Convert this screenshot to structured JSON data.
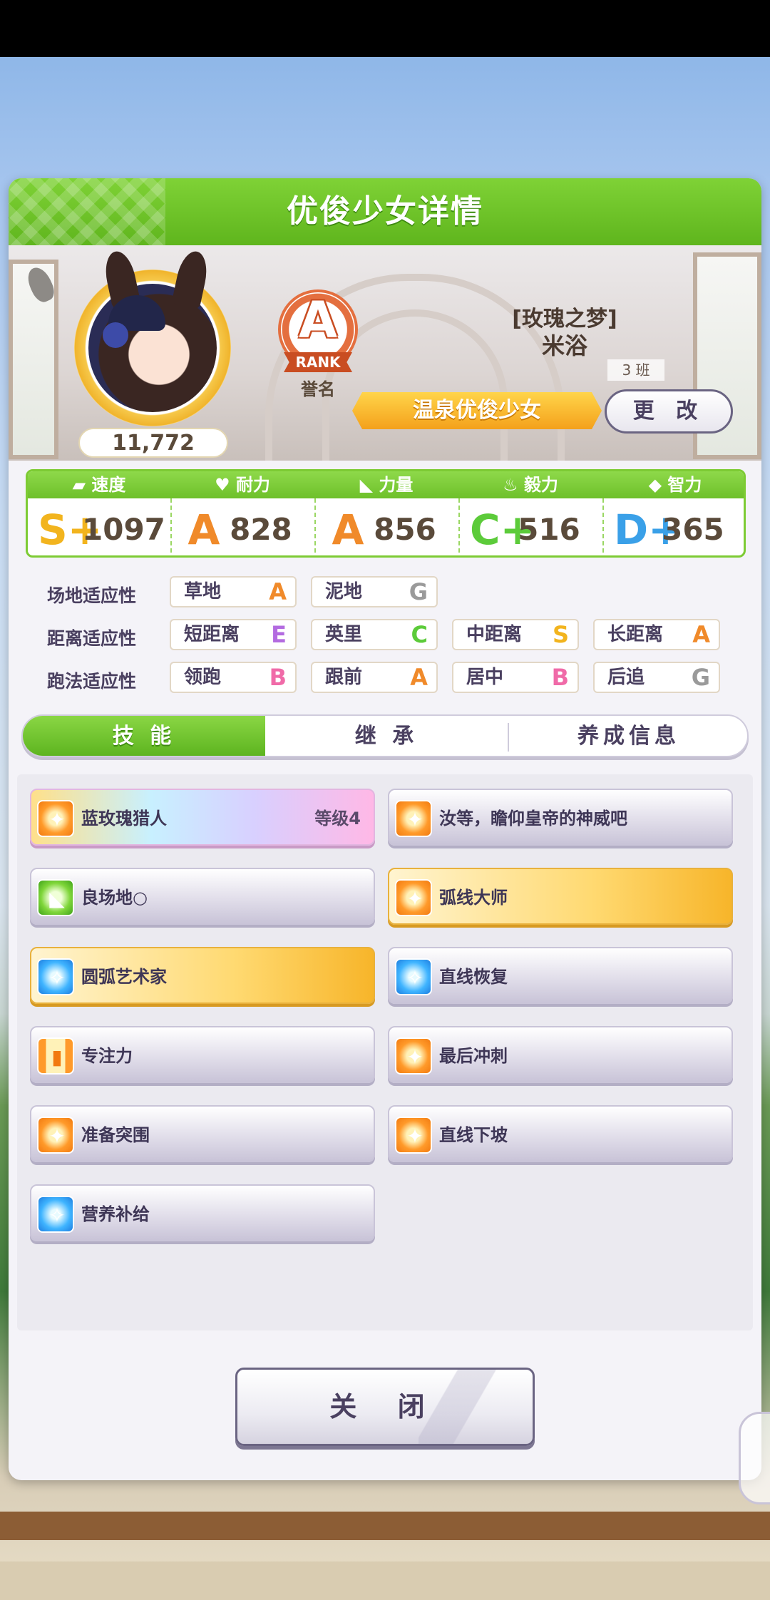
{
  "dialog": {
    "title": "优俊少女详情"
  },
  "profile": {
    "fan_count": "11,772",
    "rank": {
      "letter": "A",
      "ribbon": "RANK",
      "label": "誉名"
    },
    "epithet": "[玫瑰之梦]",
    "name": "米浴",
    "class_tag": "3 班",
    "title": "温泉优俊少女",
    "change_label": "更 改"
  },
  "stats": [
    {
      "label": "速度",
      "grade": "S+",
      "value": "1097",
      "color": "#f2b41e"
    },
    {
      "label": "耐力",
      "grade": "A",
      "value": "828",
      "color": "#f08a2a"
    },
    {
      "label": "力量",
      "grade": "A",
      "value": "856",
      "color": "#f08a2a"
    },
    {
      "label": "毅力",
      "grade": "C+",
      "value": "516",
      "color": "#5ccb3a"
    },
    {
      "label": "智力",
      "grade": "D+",
      "value": "365",
      "color": "#3aa0e8"
    }
  ],
  "aptitude": {
    "track": {
      "label": "场地适应性",
      "items": [
        {
          "name": "草地",
          "grade": "A"
        },
        {
          "name": "泥地",
          "grade": "G"
        }
      ]
    },
    "distance": {
      "label": "距离适应性",
      "items": [
        {
          "name": "短距离",
          "grade": "E"
        },
        {
          "name": "英里",
          "grade": "C"
        },
        {
          "name": "中距离",
          "grade": "S"
        },
        {
          "name": "长距离",
          "grade": "A"
        }
      ]
    },
    "style": {
      "label": "跑法适应性",
      "items": [
        {
          "name": "领跑",
          "grade": "B"
        },
        {
          "name": "跟前",
          "grade": "A"
        },
        {
          "name": "居中",
          "grade": "B"
        },
        {
          "name": "后追",
          "grade": "G"
        }
      ]
    }
  },
  "grade_colors": {
    "S": "#f2b41e",
    "A": "#f08a2a",
    "B": "#f06aa8",
    "C": "#5ccb3a",
    "E": "#b36be0",
    "G": "#9a9a9a"
  },
  "tabs": [
    {
      "label": "技 能",
      "active": true
    },
    {
      "label": "继 承",
      "active": false
    },
    {
      "label": "养成信息",
      "active": false
    }
  ],
  "skills": [
    {
      "name": "蓝玫瑰猎人",
      "level": "等级4",
      "style": "rainbow",
      "icon": "orange-speed-icon"
    },
    {
      "name": "汝等，瞻仰皇帝的神威吧",
      "level": "",
      "style": "normal",
      "icon": "orange-speed-icon"
    },
    {
      "name": "良场地○",
      "level": "",
      "style": "normal",
      "icon": "green-power-icon"
    },
    {
      "name": "弧线大师",
      "level": "",
      "style": "gold",
      "icon": "orange-speed-icon"
    },
    {
      "name": "圆弧艺术家",
      "level": "",
      "style": "gold",
      "icon": "blue-recovery-icon"
    },
    {
      "name": "直线恢复",
      "level": "",
      "style": "normal",
      "icon": "blue-recovery-icon"
    },
    {
      "name": "专注力",
      "level": "",
      "style": "normal",
      "icon": "gate-icon"
    },
    {
      "name": "最后冲刺",
      "level": "",
      "style": "normal",
      "icon": "orange-speed-icon"
    },
    {
      "name": "准备突围",
      "level": "",
      "style": "normal",
      "icon": "orange-speed-icon"
    },
    {
      "name": "直线下坡",
      "level": "",
      "style": "normal",
      "icon": "orange-speed-icon"
    },
    {
      "name": "营养补给",
      "level": "",
      "style": "normal",
      "icon": "blue-recovery-icon"
    }
  ],
  "close_label": "关 闭"
}
